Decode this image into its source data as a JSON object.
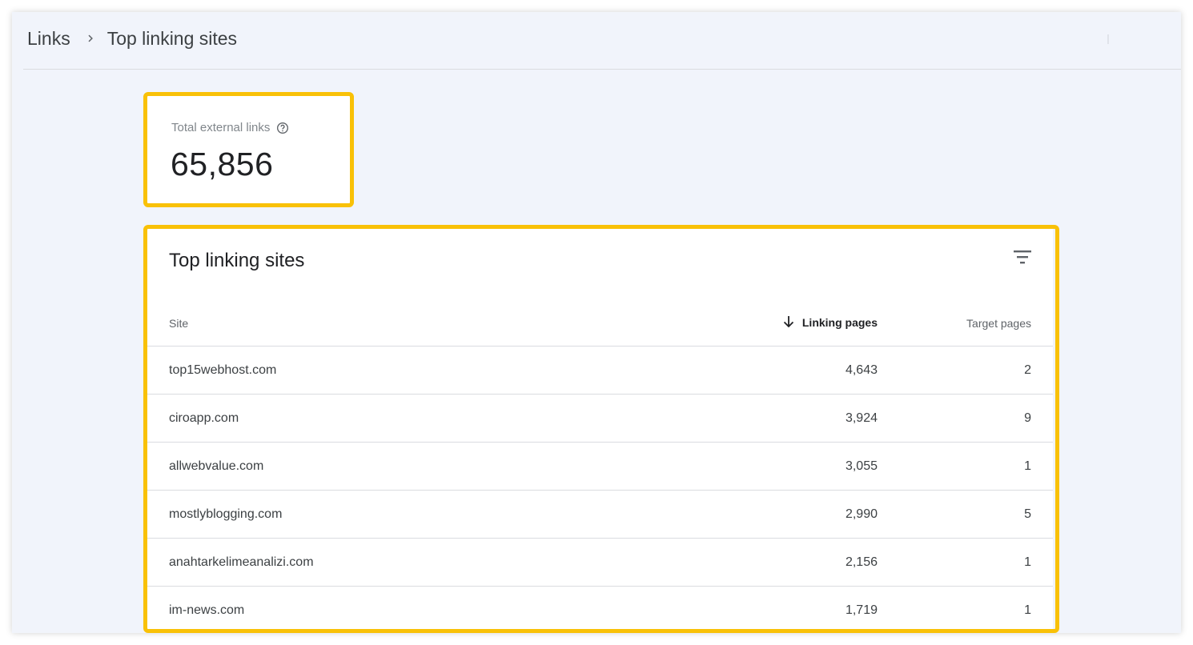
{
  "breadcrumb": {
    "parent": "Links",
    "current": "Top linking sites"
  },
  "kpi": {
    "label": "Total external links",
    "value": "65,856"
  },
  "table": {
    "title": "Top linking sites",
    "columns": {
      "site": "Site",
      "linking_pages": "Linking pages",
      "target_pages": "Target pages"
    },
    "sorted_by": "Linking pages",
    "rows": [
      {
        "site": "top15webhost.com",
        "linking_pages": "4,643",
        "target_pages": "2"
      },
      {
        "site": "ciroapp.com",
        "linking_pages": "3,924",
        "target_pages": "9"
      },
      {
        "site": "allwebvalue.com",
        "linking_pages": "3,055",
        "target_pages": "1"
      },
      {
        "site": "mostlyblogging.com",
        "linking_pages": "2,990",
        "target_pages": "5"
      },
      {
        "site": "anahtarkelimeanalizi.com",
        "linking_pages": "2,156",
        "target_pages": "1"
      },
      {
        "site": "im-news.com",
        "linking_pages": "1,719",
        "target_pages": "1"
      }
    ]
  },
  "icons": {
    "breadcrumb_separator": "chevron-right-icon",
    "help": "help-circle-icon",
    "filter": "filter-list-icon",
    "sort": "arrow-downward-icon"
  },
  "colors": {
    "highlight": "#f9c107",
    "page_background": "#f1f4fb",
    "card_background": "#ffffff"
  }
}
